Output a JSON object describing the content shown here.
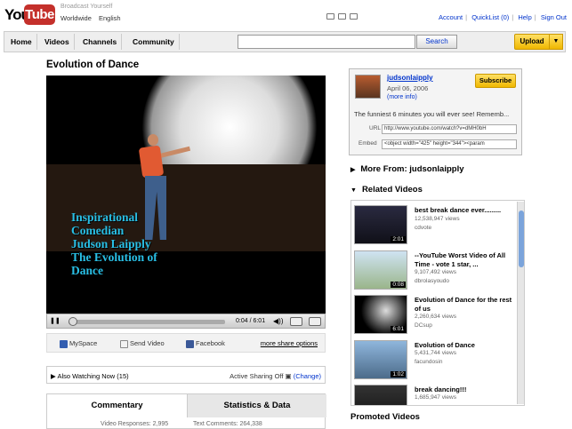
{
  "header": {
    "logo_you": "You",
    "logo_tube": "Tube",
    "tagline": "Broadcast Yourself",
    "locale_region": "Worldwide",
    "locale_language": "English",
    "top_links": [
      "Account",
      "QuickList (0)",
      "Help",
      "Sign Out"
    ]
  },
  "nav": {
    "tabs": [
      "Home",
      "Videos",
      "Channels",
      "Community"
    ],
    "search_value": "",
    "search_button": "Search",
    "upload_button": "Upload",
    "upload_dropdown": "▼"
  },
  "video": {
    "title": "Evolution of Dance",
    "overlay_lines": [
      "Inspirational",
      "Comedian",
      "Judson Laipply",
      "The Evolution of",
      "Dance"
    ],
    "time": "0:04 / 6:01",
    "progress": 0.01
  },
  "share": {
    "myspace": "MySpace",
    "send_video": "Send Video",
    "facebook": "Facebook",
    "more_share": "more share options"
  },
  "also_watching": {
    "label": "Also Watching Now",
    "count": "(15)",
    "active_sharing": "Active Sharing Off",
    "change": "(Change)"
  },
  "tabs": {
    "commentary": "Commentary",
    "statistics": "Statistics & Data",
    "commentary_sub": "Video Responses: 2,995",
    "statistics_sub": "Text Comments: 264,338"
  },
  "uploader": {
    "name": "judsonlaipply",
    "date": "April 06, 2006",
    "more_info": "(more info)",
    "subscribe": "Subscribe",
    "description": "The funniest 6 minutes you will ever see! Rememb...",
    "url_label": "URL",
    "url_value": "http://www.youtube.com/watch?v=dMH0bH",
    "embed_label": "Embed",
    "embed_value": "<object width=\"425\" height=\"344\"><param"
  },
  "sections": {
    "more_from": "More From: judsonlaipply",
    "related": "Related Videos",
    "promoted": "Promoted Videos"
  },
  "related_videos": [
    {
      "title": "best break dance ever.........",
      "views": "12,538,947 views",
      "user": "cdvote",
      "duration": "2:01"
    },
    {
      "title": "--YouTube Worst Video of All Time - vote 1 star, ...",
      "views": "9,107,492 views",
      "user": "dbrolasyoudo",
      "duration": "0:08"
    },
    {
      "title": "Evolution of Dance for the rest of us",
      "views": "2,260,634 views",
      "user": "DCsup",
      "duration": "6:01"
    },
    {
      "title": "Evolution of Dance",
      "views": "5,431,744 views",
      "user": "facundosin",
      "duration": "1:02"
    },
    {
      "title": "break dancing!!!",
      "views": "1,685,947 views",
      "user": "",
      "duration": ""
    }
  ],
  "colors": {
    "brand_red": "#c4302b",
    "link_blue": "#0033cc",
    "subscribe_yellow": "#f0b800",
    "overlay_cyan": "#29bfe5"
  }
}
